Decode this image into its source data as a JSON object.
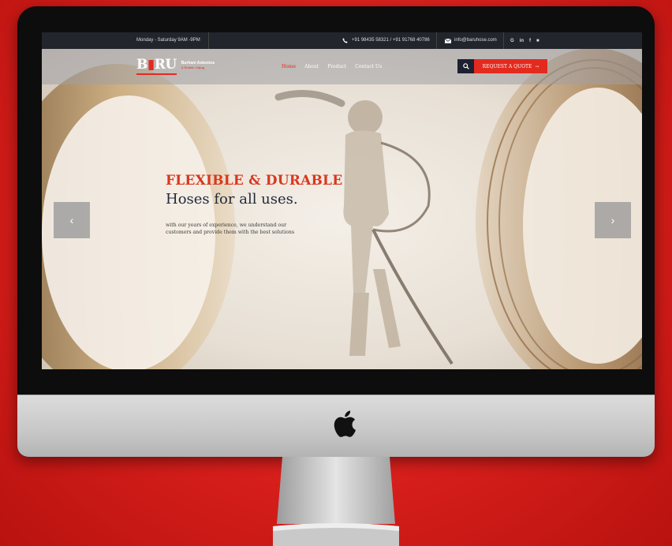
{
  "topbar": {
    "hours": "Monday - Saturday 9AM -9PM",
    "phone": "+91 98435 58321 / +91 91768 40786",
    "email": "info@baruhose.com",
    "socials": [
      "G",
      "in",
      "f",
      "■"
    ]
  },
  "brand": {
    "logo_b": "B",
    "logo_o": "",
    "logo_ru": "RU",
    "line1": "Burhani Asbestos",
    "line2": "& Rubber Udyog"
  },
  "nav": {
    "items": [
      "Home",
      "About",
      "Product",
      "Contact Us"
    ],
    "active_index": 0,
    "quote_label": "REQUEST A QUOTE",
    "quote_arrow": "→"
  },
  "hero": {
    "title": "FLEXIBLE & DURABLE",
    "subtitle": "Hoses for all uses.",
    "description": "with our years of experience, we understand our customers and provide them with the best solutions"
  },
  "carousel": {
    "prev": "‹",
    "next": "›"
  },
  "colors": {
    "accent": "#e32a1e",
    "topbar": "#23252d",
    "background": "#d81f1c"
  }
}
